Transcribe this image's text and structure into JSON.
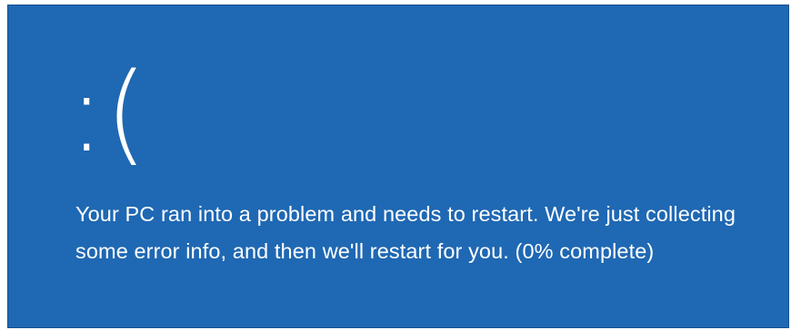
{
  "screen": {
    "background_color": "#1f68b3",
    "text_color": "#ffffff",
    "emoticon": ":(",
    "message": "Your PC ran into a problem and needs to restart. We're just collecting some error info, and then we'll restart for you.",
    "progress": {
      "percent": 0,
      "label": "(0% complete)"
    }
  }
}
